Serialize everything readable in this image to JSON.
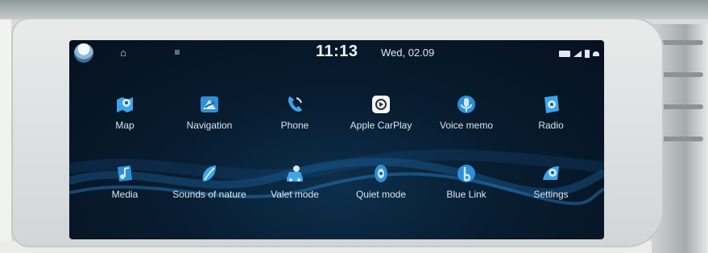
{
  "status_bar": {
    "time": "11:13",
    "date": "Wed, 02.09",
    "home_icon": "home-icon",
    "menu_icon": "menu-icon"
  },
  "apps": [
    {
      "label": "Map",
      "icon": "map-icon"
    },
    {
      "label": "Navigation",
      "icon": "navigation-icon"
    },
    {
      "label": "Phone",
      "icon": "phone-icon"
    },
    {
      "label": "Apple CarPlay",
      "icon": "carplay-icon"
    },
    {
      "label": "Voice memo",
      "icon": "voice-memo-icon"
    },
    {
      "label": "Radio",
      "icon": "radio-icon"
    },
    {
      "label": "Media",
      "icon": "media-icon"
    },
    {
      "label": "Sounds of nature",
      "icon": "sounds-of-nature-icon"
    },
    {
      "label": "Valet mode",
      "icon": "valet-mode-icon"
    },
    {
      "label": "Quiet mode",
      "icon": "quiet-mode-icon"
    },
    {
      "label": "Blue Link",
      "icon": "blue-link-icon"
    },
    {
      "label": "Settings",
      "icon": "settings-icon"
    }
  ],
  "colors": {
    "screen_bg": "#081c30",
    "icon_accent": "#3fa4e6",
    "text": "#d9e6f1"
  }
}
